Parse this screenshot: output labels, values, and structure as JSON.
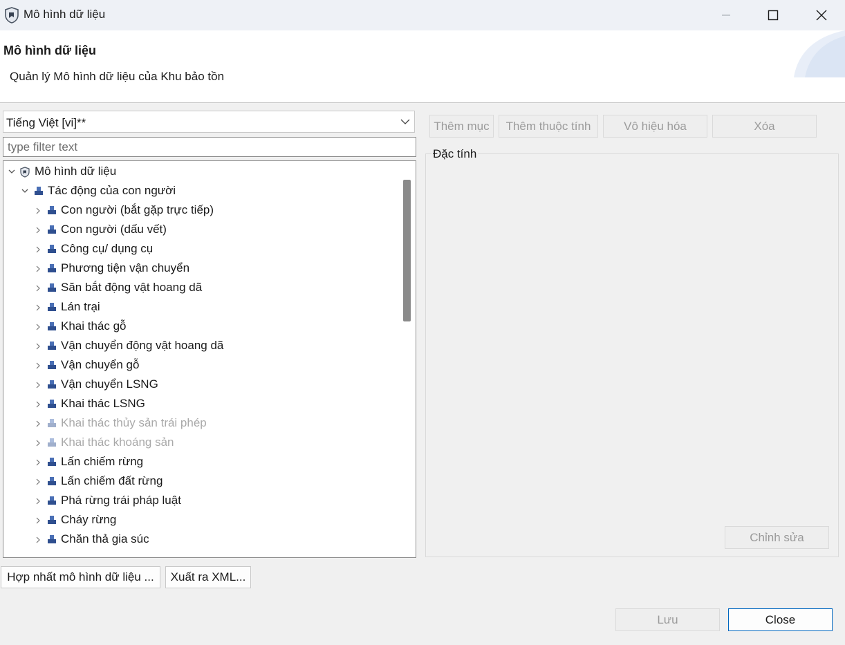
{
  "window": {
    "title": "Mô hình dữ liệu",
    "controls": [
      "minimize-icon",
      "maximize-icon",
      "close-icon"
    ]
  },
  "header": {
    "title": "Mô hình dữ liệu",
    "description": "Quản lý Mô hình dữ liệu của Khu bảo tồn"
  },
  "language_select": {
    "value": "Tiếng Việt [vi]**"
  },
  "filter": {
    "placeholder": "type filter text",
    "value": ""
  },
  "tree": {
    "root": {
      "label": "Mô hình dữ liệu",
      "expanded": true,
      "icon": "shield-icon"
    },
    "category": {
      "label": "Tác động của con người",
      "expanded": true,
      "icon": "category-icon"
    },
    "items": [
      {
        "label": "Con người (bắt gặp trực tiếp)",
        "enabled": true
      },
      {
        "label": "Con người (dấu vết)",
        "enabled": true
      },
      {
        "label": "Công cụ/ dụng cụ",
        "enabled": true
      },
      {
        "label": "Phương tiện vận chuyển",
        "enabled": true
      },
      {
        "label": "Săn bắt động vật hoang dã",
        "enabled": true
      },
      {
        "label": "Lán trại",
        "enabled": true
      },
      {
        "label": "Khai thác gỗ",
        "enabled": true
      },
      {
        "label": "Vận chuyển động vật hoang dã",
        "enabled": true
      },
      {
        "label": "Vận chuyển gỗ",
        "enabled": true
      },
      {
        "label": "Vận chuyển LSNG",
        "enabled": true
      },
      {
        "label": "Khai thác LSNG",
        "enabled": true
      },
      {
        "label": "Khai thác thủy sản trái phép",
        "enabled": false
      },
      {
        "label": "Khai thác khoáng sản",
        "enabled": false
      },
      {
        "label": "Lấn chiếm rừng",
        "enabled": true
      },
      {
        "label": "Lấn chiếm đất rừng",
        "enabled": true
      },
      {
        "label": "Phá rừng trái pháp luật",
        "enabled": true
      },
      {
        "label": "Cháy rừng",
        "enabled": true
      },
      {
        "label": "Chăn thả gia súc",
        "enabled": true
      }
    ]
  },
  "toolbar": {
    "add_item": "Thêm mục",
    "add_attribute": "Thêm thuộc tính",
    "disable": "Vô hiệu hóa",
    "delete": "Xóa"
  },
  "properties": {
    "title": "Đặc tính",
    "edit_label": "Chỉnh sửa"
  },
  "bottom": {
    "merge_label": "Hợp nhất mô hình dữ liệu ...",
    "export_label": "Xuất ra XML..."
  },
  "footer": {
    "save_label": "Lưu",
    "close_label": "Close"
  },
  "colors": {
    "accent": "#0067c0",
    "tree_icon": "#2f4f8f",
    "disabled_text": "#a9a9a9"
  }
}
